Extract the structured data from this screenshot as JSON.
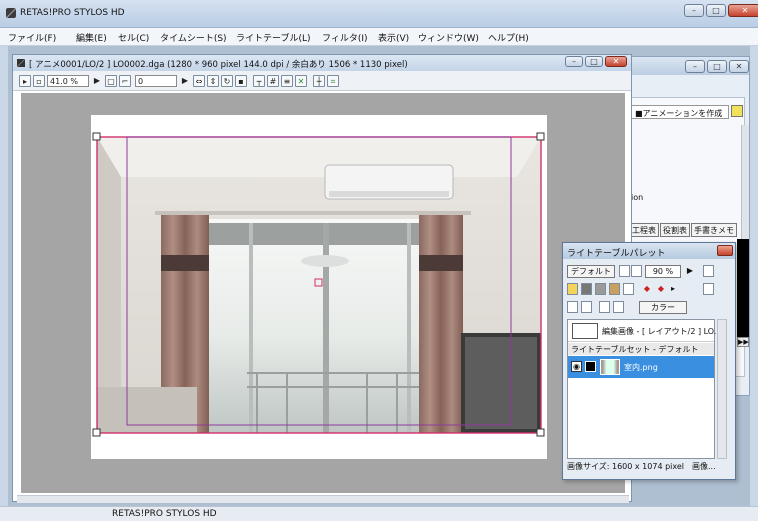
{
  "app": {
    "title": "RETAS!PRO STYLOS HD"
  },
  "menu": [
    "ファイル(F)",
    "編集(E)",
    "セル(C)",
    "タイムシート(S)",
    "ライトテーブル(L)",
    "フィルタ(I)",
    "表示(V)",
    "ウィンドウ(W)",
    "ヘルプ(H)"
  ],
  "document": {
    "title": "[ アニメ0001/LO/2 ] LO0002.dga (1280 * 960 pixel 144.0 dpi / 余白あり 1506 * 1130 pixel)",
    "zoom": "41.0 %",
    "frame": "0"
  },
  "right_panel": {
    "animation_dropdown": "■アニメーションを作成",
    "partial_text": "ion",
    "tabs": [
      "工程表",
      "役割表",
      "手書きメモ"
    ],
    "side_button": "▶▶"
  },
  "light_table": {
    "title": "ライトテーブルパレット",
    "preset": "デフォルト",
    "opacity": "90 %",
    "color_mode": "カラー",
    "edit_label": "編集画像 - [ レイアウト/2 ] LO...",
    "set_header": "ライトテーブルセット - デフォルト",
    "layer_name": "室内.png",
    "footer": "画像サイズ: 1600 x 1074 pixel　画像..."
  },
  "status": {
    "text": "RETAS!PRO STYLOS HD"
  },
  "colors": {
    "accent": "#3b8fe0",
    "frame_line": "#d0306e",
    "canvas_gray": "#a5a5a5"
  }
}
